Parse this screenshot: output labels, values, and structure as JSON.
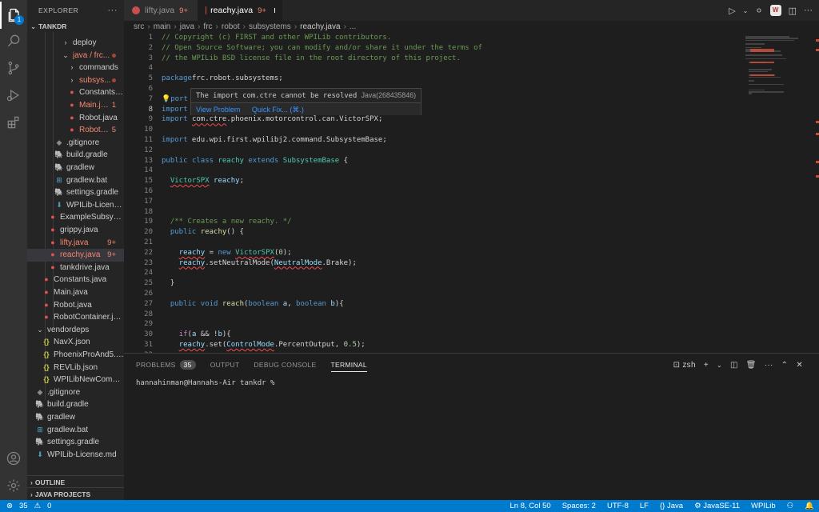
{
  "activity_bar": {
    "explorer_badge": "1",
    "icons": [
      "files-icon",
      "search-icon",
      "source-control-icon",
      "run-debug-icon",
      "extensions-icon",
      "account-icon",
      "manage-gear-icon"
    ]
  },
  "sidebar": {
    "title": "EXPLORER",
    "root": "TANKDR",
    "items": [
      {
        "label": "deploy",
        "kind": "folder",
        "indent": 3,
        "badge": ""
      },
      {
        "label": "java / frc...",
        "kind": "folder-open",
        "indent": 3,
        "badge": "",
        "error": true,
        "dot": true
      },
      {
        "label": "commands",
        "kind": "folder",
        "indent": 4,
        "badge": ""
      },
      {
        "label": "subsys...",
        "kind": "folder",
        "indent": 4,
        "badge": "",
        "error": true,
        "dot": true
      },
      {
        "label": "Constants.ja...",
        "kind": "java",
        "indent": 4,
        "badge": ""
      },
      {
        "label": "Main.java",
        "kind": "java",
        "indent": 4,
        "badge": "1",
        "error": true
      },
      {
        "label": "Robot.java",
        "kind": "java",
        "indent": 4,
        "badge": ""
      },
      {
        "label": "RobotC...",
        "kind": "java",
        "indent": 4,
        "badge": "5",
        "error": true
      },
      {
        "label": ".gitignore",
        "kind": "git",
        "indent": 2,
        "badge": ""
      },
      {
        "label": "build.gradle",
        "kind": "gradle",
        "indent": 2,
        "badge": ""
      },
      {
        "label": "gradlew",
        "kind": "gradle",
        "indent": 2,
        "badge": ""
      },
      {
        "label": "gradlew.bat",
        "kind": "bat",
        "indent": 2,
        "badge": ""
      },
      {
        "label": "settings.gradle",
        "kind": "gradle",
        "indent": 2,
        "badge": ""
      },
      {
        "label": "WPILib-Licens...",
        "kind": "md",
        "indent": 2,
        "badge": ""
      },
      {
        "label": "ExampleSubsyst...",
        "kind": "java",
        "indent": 1,
        "badge": ""
      },
      {
        "label": "grippy.java",
        "kind": "java",
        "indent": 1,
        "badge": ""
      },
      {
        "label": "lifty.java",
        "kind": "java",
        "indent": 1,
        "badge": "9+",
        "error": true
      },
      {
        "label": "reachy.java",
        "kind": "java",
        "indent": 1,
        "badge": "9+",
        "error": true,
        "selected": true
      },
      {
        "label": "tankdrive.java",
        "kind": "java",
        "indent": 1,
        "badge": ""
      },
      {
        "label": "Constants.java",
        "kind": "java",
        "indent": 0,
        "badge": ""
      },
      {
        "label": "Main.java",
        "kind": "java",
        "indent": 0,
        "badge": ""
      },
      {
        "label": "Robot.java",
        "kind": "java",
        "indent": 0,
        "badge": ""
      },
      {
        "label": "RobotContainer.ja...",
        "kind": "java",
        "indent": 0,
        "badge": ""
      },
      {
        "label": "vendordeps",
        "kind": "folder-open",
        "indent": -1,
        "badge": ""
      },
      {
        "label": "NavX.json",
        "kind": "json",
        "indent": 0,
        "badge": ""
      },
      {
        "label": "PhoenixProAnd5.js...",
        "kind": "json",
        "indent": 0,
        "badge": ""
      },
      {
        "label": "REVLib.json",
        "kind": "json",
        "indent": 0,
        "badge": ""
      },
      {
        "label": "WPILibNewComma...",
        "kind": "json",
        "indent": 0,
        "badge": ""
      },
      {
        "label": ".gitignore",
        "kind": "git",
        "indent": -1,
        "badge": ""
      },
      {
        "label": "build.gradle",
        "kind": "gradle",
        "indent": -1,
        "badge": ""
      },
      {
        "label": "gradlew",
        "kind": "gradle",
        "indent": -1,
        "badge": ""
      },
      {
        "label": "gradlew.bat",
        "kind": "bat",
        "indent": -1,
        "badge": ""
      },
      {
        "label": "settings.gradle",
        "kind": "gradle",
        "indent": -1,
        "badge": ""
      },
      {
        "label": "WPILib-License.md",
        "kind": "md",
        "indent": -1,
        "badge": ""
      }
    ],
    "outline": "OUTLINE",
    "java_projects": "JAVA PROJECTS"
  },
  "tabs": [
    {
      "label": "lifty.java",
      "badge": "9+",
      "active": false
    },
    {
      "label": "reachy.java",
      "badge": "9+",
      "active": true
    }
  ],
  "breadcrumb": [
    "src",
    "main",
    "java",
    "frc",
    "robot",
    "subsystems",
    "reachy.java",
    "..."
  ],
  "editor": {
    "current_line": 8,
    "lines": [
      [
        [
          "c-com",
          "// Copyright (c) FIRST and other WPILib contributors."
        ]
      ],
      [
        [
          "c-com",
          "// Open Source Software; you can modify and/or share it under the terms of"
        ]
      ],
      [
        [
          "c-com",
          "// the WPILib BSD license file in the root directory of this project."
        ]
      ],
      [],
      [
        [
          "c-kw",
          "package"
        ],
        [
          "",
          "frc.robot.subsystems;"
        ]
      ],
      [],
      [
        [
          "bulb",
          "💡"
        ],
        [
          "c-kw",
          "port"
        ]
      ],
      [
        [
          "c-kw",
          "import"
        ]
      ],
      [
        [
          "c-kw",
          "import"
        ],
        [
          "",
          " "
        ],
        [
          "sq",
          "com.ctre"
        ],
        [
          "",
          ".phoenix.motorcontrol.can.VictorSPX;"
        ]
      ],
      [],
      [
        [
          "c-kw",
          "import"
        ],
        [
          "",
          " edu.wpi.first.wpilibj2.command.SubsystemBase;"
        ]
      ],
      [],
      [
        [
          "c-kw",
          "public"
        ],
        [
          "",
          " "
        ],
        [
          "c-kw",
          "class"
        ],
        [
          "",
          " "
        ],
        [
          "c-type",
          "reachy"
        ],
        [
          "",
          " "
        ],
        [
          "c-kw",
          "extends"
        ],
        [
          "",
          " "
        ],
        [
          "c-type",
          "SubsystemBase"
        ],
        [
          "",
          " {"
        ]
      ],
      [],
      [
        [
          "",
          "  "
        ],
        [
          "c-type sq",
          "VictorSPX"
        ],
        [
          "",
          " "
        ],
        [
          "c-var",
          "reachy"
        ],
        [
          "",
          ";"
        ]
      ],
      [],
      [],
      [],
      [
        [
          "",
          "  "
        ],
        [
          "c-com",
          "/** Creates a new reachy. */"
        ]
      ],
      [
        [
          "",
          "  "
        ],
        [
          "c-kw",
          "public"
        ],
        [
          "",
          " "
        ],
        [
          "c-fn",
          "reachy"
        ],
        [
          "",
          "() {"
        ]
      ],
      [],
      [
        [
          "",
          "    "
        ],
        [
          "c-var sq",
          "reachy"
        ],
        [
          "",
          " = "
        ],
        [
          "c-kw",
          "new"
        ],
        [
          "",
          " "
        ],
        [
          "c-type sq",
          "VictorSPX"
        ],
        [
          "",
          "("
        ],
        [
          "c-num",
          "0"
        ],
        [
          "",
          ");"
        ]
      ],
      [
        [
          "",
          "    "
        ],
        [
          "c-var sq",
          "reachy"
        ],
        [
          "",
          ".setNeutralMode("
        ],
        [
          "c-var sq",
          "NeutralMode"
        ],
        [
          "",
          ".Brake);"
        ]
      ],
      [],
      [
        [
          "",
          "  }"
        ]
      ],
      [],
      [
        [
          "",
          "  "
        ],
        [
          "c-kw",
          "public"
        ],
        [
          "",
          " "
        ],
        [
          "c-kw",
          "void"
        ],
        [
          "",
          " "
        ],
        [
          "c-fn",
          "reach"
        ],
        [
          "",
          "("
        ],
        [
          "c-kw",
          "boolean"
        ],
        [
          "",
          " "
        ],
        [
          "c-var",
          "a"
        ],
        [
          "",
          ", "
        ],
        [
          "c-kw",
          "boolean"
        ],
        [
          "",
          " "
        ],
        [
          "c-var",
          "b"
        ],
        [
          "",
          "){"
        ]
      ],
      [],
      [],
      [
        [
          "",
          "    "
        ],
        [
          "c-kw2",
          "if"
        ],
        [
          "",
          "("
        ],
        [
          "c-var",
          "a"
        ],
        [
          "",
          " && !"
        ],
        [
          "c-var",
          "b"
        ],
        [
          "",
          "){"
        ]
      ],
      [
        [
          "",
          "    "
        ],
        [
          "c-var sq",
          "reachy"
        ],
        [
          "",
          ".set("
        ],
        [
          "c-var sq",
          "ControlMode"
        ],
        [
          "",
          ".PercentOutput, "
        ],
        [
          "c-num",
          "0.5"
        ],
        [
          "",
          ");"
        ]
      ],
      [
        [
          "",
          "    "
        ]
      ]
    ]
  },
  "hover": {
    "message": "The import com.ctre cannot be resolved",
    "source": "Java(268435846)",
    "action_view": "View Problem",
    "action_fix": "Quick Fix... (⌘.)"
  },
  "panel": {
    "tabs": [
      {
        "label": "PROBLEMS",
        "count": "35"
      },
      {
        "label": "OUTPUT"
      },
      {
        "label": "DEBUG CONSOLE"
      },
      {
        "label": "TERMINAL",
        "active": true
      }
    ],
    "shell": "zsh",
    "terminal_text": "hannahinman@Hannahs-Air tankdr %"
  },
  "status": {
    "errors": "35",
    "warnings": "0",
    "position": "Ln 8, Col 50",
    "spaces": "Spaces: 2",
    "encoding": "UTF-8",
    "eol": "LF",
    "language": "Java",
    "java_version": "JavaSE-11",
    "wpilib": "WPILib"
  }
}
